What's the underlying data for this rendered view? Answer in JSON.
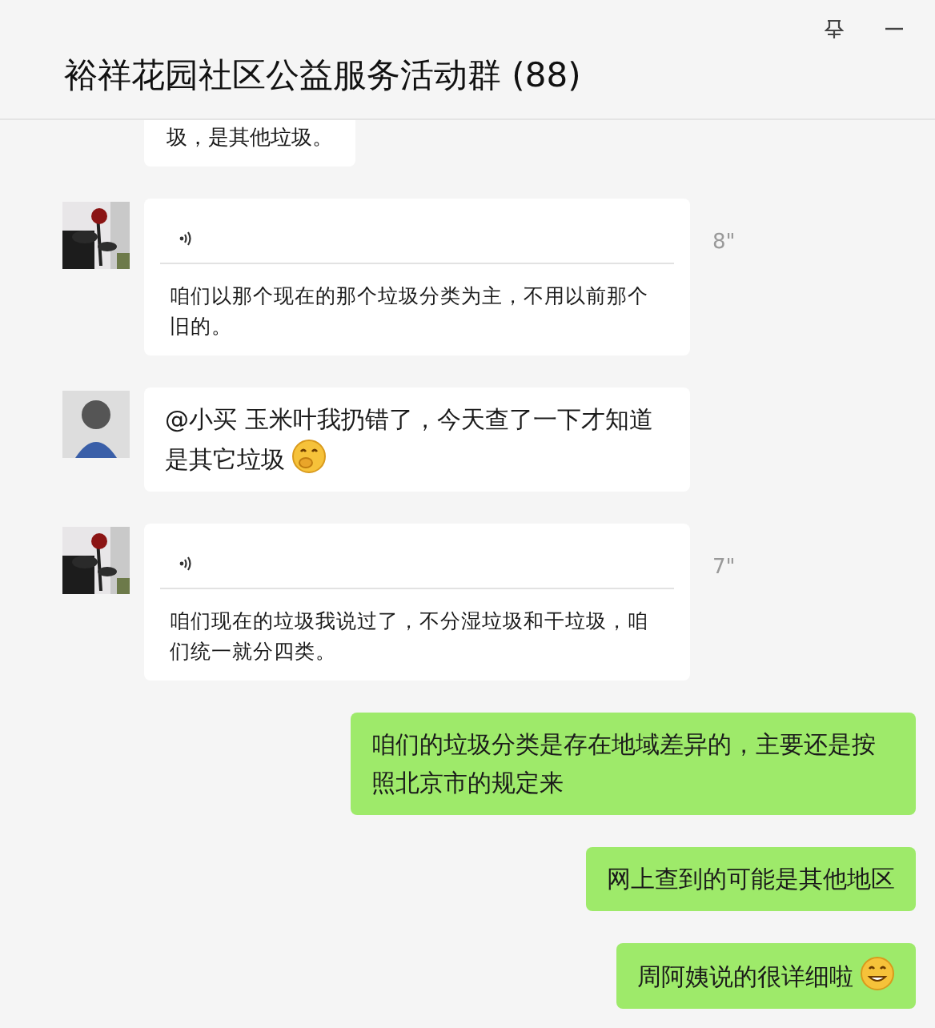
{
  "window": {
    "title": "裕祥花园社区公益服务活动群 (88)"
  },
  "messages": [
    {
      "kind": "partial",
      "outgoing": false,
      "text": "圾，是其他垃圾。"
    },
    {
      "kind": "voice",
      "outgoing": false,
      "duration": "8\"",
      "text": "咱们以那个现在的那个垃圾分类为主，不用以前那个旧的。"
    },
    {
      "kind": "text",
      "outgoing": false,
      "avatar": {
        "kind": "figure"
      },
      "text": "@小买 玉米叶我扔错了，今天查了一下才知道是其它垃圾",
      "emoji": {
        "kind": "cover"
      }
    },
    {
      "kind": "voice",
      "outgoing": false,
      "duration": "7\"",
      "text": "咱们现在的垃圾我说过了，不分湿垃圾和干垃圾，咱们统一就分四类。"
    },
    {
      "kind": "text",
      "outgoing": true,
      "text": "咱们的垃圾分类是存在地域差异的，主要还是按照北京市的规定来"
    },
    {
      "kind": "text",
      "outgoing": true,
      "text": "网上查到的可能是其他地区"
    },
    {
      "kind": "text",
      "outgoing": true,
      "text": "周阿姨说的很详细啦",
      "emoji": {
        "kind": "grin"
      }
    }
  ]
}
